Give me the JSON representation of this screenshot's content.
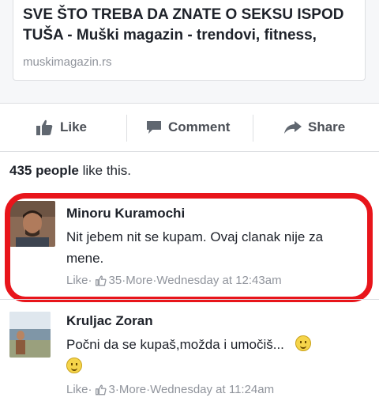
{
  "link": {
    "title": "SVE ŠTO TREBA DA ZNATE O SEKSU ISPOD\nTUŠA - Muški magazin - trendovi, fitness,",
    "domain": "muskimagazin.rs"
  },
  "actions": {
    "like": "Like",
    "comment": "Comment",
    "share": "Share"
  },
  "likes": {
    "count": "435 people",
    "suffix": " like this."
  },
  "comments": [
    {
      "author": "Minoru Kuramochi",
      "text": "Nit jebem nit se kupam. Ovaj clanak nije za mene.",
      "like": "Like",
      "dot1": " · ",
      "likes": "35",
      "more": "More",
      "dot2": " · ",
      "time": "Wednesday at 12:43am"
    },
    {
      "author": "Kruljac Zoran",
      "text": "Počni da se kupaš,možda i umočiš...",
      "like": "Like",
      "dot1": " · ",
      "likes": "3",
      "more": "More",
      "dot2": " · ",
      "time": "Wednesday at 11:24am"
    }
  ],
  "colors": {
    "highlight": "#e8151b",
    "secondary_text": "#90949c",
    "action_text": "#4b4f56"
  }
}
